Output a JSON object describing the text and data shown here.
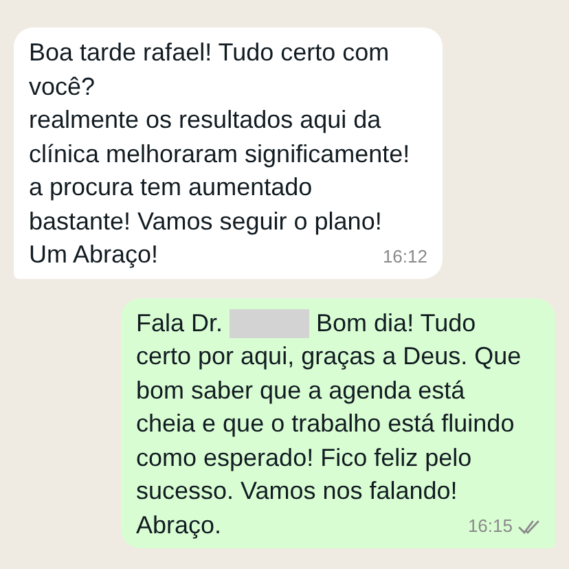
{
  "messages": [
    {
      "kind": "incoming",
      "lines": [
        [
          {
            "kind": "text",
            "text": "Boa tarde rafael! Tudo certo com"
          }
        ],
        [
          {
            "kind": "text",
            "text": "você?"
          }
        ],
        [
          {
            "kind": "text",
            "text": "realmente os resultados aqui da"
          }
        ],
        [
          {
            "kind": "text",
            "text": "clínica melhoraram significamente!"
          }
        ],
        [
          {
            "kind": "text",
            "text": "a procura tem aumentado"
          }
        ],
        [
          {
            "kind": "text",
            "text": "bastante! Vamos seguir o plano!"
          }
        ],
        [
          {
            "kind": "text",
            "text": "Um Abraço!"
          }
        ]
      ],
      "time": "16:12"
    },
    {
      "kind": "outgoing",
      "lines": [
        [
          {
            "kind": "text",
            "text": "Fala Dr."
          },
          {
            "kind": "redacted"
          },
          {
            "kind": "text",
            "text": "Bom dia! Tudo"
          }
        ],
        [
          {
            "kind": "text",
            "text": "certo por aqui, graças a Deus. Que"
          }
        ],
        [
          {
            "kind": "text",
            "text": "bom saber que a agenda está"
          }
        ],
        [
          {
            "kind": "text",
            "text": "cheia e que o trabalho está fluindo"
          }
        ],
        [
          {
            "kind": "text",
            "text": "como esperado! Fico feliz pelo"
          }
        ],
        [
          {
            "kind": "text",
            "text": "sucesso. Vamos nos falando!"
          }
        ],
        [
          {
            "kind": "text",
            "text": "Abraço."
          }
        ]
      ],
      "time": "16:15",
      "read": false
    }
  ]
}
